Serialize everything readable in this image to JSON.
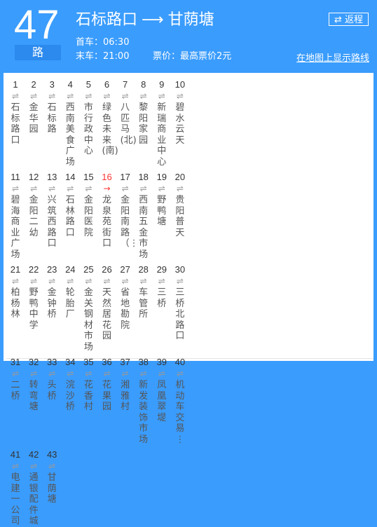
{
  "header": {
    "line_number": "47",
    "line_suffix": "路",
    "from": "石标路口",
    "arrow": "⟶",
    "to": "甘荫塘",
    "first_bus": "首车：06:30",
    "last_bus": "末车：21:00",
    "fare": "票价：最高票价2元",
    "reverse_icon": "⇄",
    "reverse_label": "返程",
    "map_link": "在地图上显示路线"
  },
  "colors": {
    "background": "#3a9cfd",
    "current_stop": "#ff3333"
  },
  "current_stop_index": 16,
  "stops": [
    {
      "n": "1",
      "name": "石标路口"
    },
    {
      "n": "2",
      "name": "金华园"
    },
    {
      "n": "3",
      "name": "石标路"
    },
    {
      "n": "4",
      "name": "西南美食广场"
    },
    {
      "n": "5",
      "name": "市行政中心"
    },
    {
      "n": "6",
      "name": "绿色未来(南)"
    },
    {
      "n": "7",
      "name": "八匹马(北)"
    },
    {
      "n": "8",
      "name": "黎阳家园"
    },
    {
      "n": "9",
      "name": "新瑞商业中心"
    },
    {
      "n": "10",
      "name": "碧水云天"
    },
    {
      "n": "11",
      "name": "碧海商业广场"
    },
    {
      "n": "12",
      "name": "金阳二幼"
    },
    {
      "n": "13",
      "name": "兴筑西路口"
    },
    {
      "n": "14",
      "name": "石林路口"
    },
    {
      "n": "15",
      "name": "金阳医院"
    },
    {
      "n": "16",
      "name": "龙泉苑街口"
    },
    {
      "n": "17",
      "name": "金阳南路（⋮"
    },
    {
      "n": "18",
      "name": "西南五金市场"
    },
    {
      "n": "19",
      "name": "野鸭塘"
    },
    {
      "n": "20",
      "name": "贵阳普天"
    },
    {
      "n": "21",
      "name": "柏杨林"
    },
    {
      "n": "22",
      "name": "野鸭中学"
    },
    {
      "n": "23",
      "name": "金钟桥"
    },
    {
      "n": "24",
      "name": "轮胎厂"
    },
    {
      "n": "25",
      "name": "金关钢材市场"
    },
    {
      "n": "26",
      "name": "天然居花园"
    },
    {
      "n": "27",
      "name": "省地勘院"
    },
    {
      "n": "28",
      "name": "车管所"
    },
    {
      "n": "29",
      "name": "三桥"
    },
    {
      "n": "30",
      "name": "三桥北路口"
    },
    {
      "n": "31",
      "name": "二桥"
    },
    {
      "n": "32",
      "name": "转弯塘"
    },
    {
      "n": "33",
      "name": "头桥"
    },
    {
      "n": "34",
      "name": "浣沙桥"
    },
    {
      "n": "35",
      "name": "花香村"
    },
    {
      "n": "36",
      "name": "花果园"
    },
    {
      "n": "37",
      "name": "湘雅村"
    },
    {
      "n": "38",
      "name": "新发装饰市场"
    },
    {
      "n": "39",
      "name": "凤凰翠堤"
    },
    {
      "n": "40",
      "name": "机动车交易⋮"
    },
    {
      "n": "41",
      "name": "电建一公司"
    },
    {
      "n": "42",
      "name": "通银配件城"
    },
    {
      "n": "43",
      "name": "甘荫塘"
    }
  ],
  "arrows": {
    "two_way": "⇌",
    "one_way": "→"
  }
}
